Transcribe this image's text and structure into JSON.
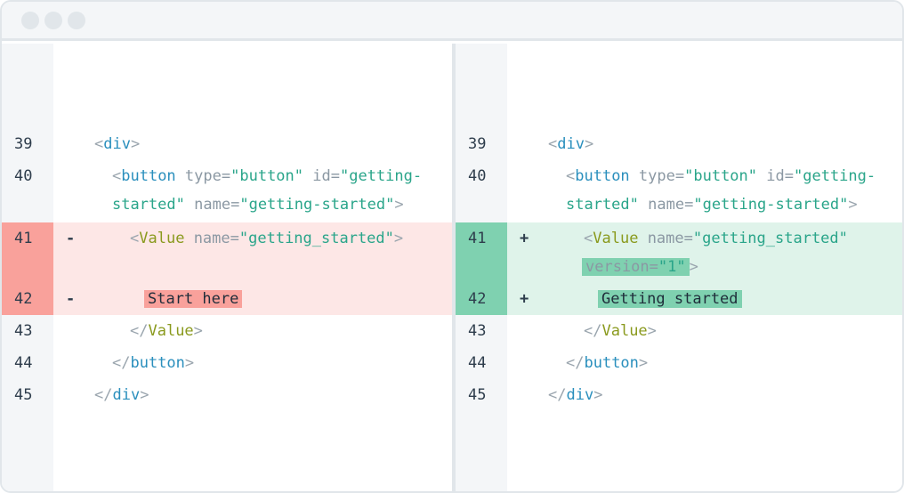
{
  "window": {
    "controls": [
      "window-dot-1",
      "window-dot-2",
      "window-dot-3"
    ]
  },
  "left": {
    "lines": [
      {
        "num": "39",
        "open": "<",
        "tag": "div",
        "close": ">"
      },
      {
        "num": "40",
        "open": "<",
        "tag": "button",
        "attr1": "type",
        "eq": "=",
        "val1": "\"button\"",
        "attr2": "id",
        "val2a": "\"getting-",
        "val2b": "started\"",
        "attr3": "name",
        "val3": "\"getting-started\"",
        "close": ">"
      },
      {
        "num": "41",
        "sign": "-",
        "open": "<",
        "tag": "Value",
        "attr1": "name",
        "eq": "=",
        "val1": "\"getting_started\"",
        "close": ">"
      },
      {
        "num": "42",
        "sign": "-",
        "text": "Start here"
      },
      {
        "num": "43",
        "open": "</",
        "tag": "Value",
        "close": ">"
      },
      {
        "num": "44",
        "open": "</",
        "tag": "button",
        "close": ">"
      },
      {
        "num": "45",
        "open": "</",
        "tag": "div",
        "close": ">"
      }
    ]
  },
  "right": {
    "lines": [
      {
        "num": "39",
        "open": "<",
        "tag": "div",
        "close": ">"
      },
      {
        "num": "40",
        "open": "<",
        "tag": "button",
        "attr1": "type",
        "eq": "=",
        "val1": "\"button\"",
        "attr2": "id",
        "val2a": "\"getting-",
        "val2b": "started\"",
        "attr3": "name",
        "val3": "\"getting-started\"",
        "close": ">"
      },
      {
        "num": "41",
        "sign": "+",
        "open": "<",
        "tag": "Value",
        "attr1": "name",
        "eq": "=",
        "val1": "\"getting_started\"",
        "attr2": "version",
        "val2": "\"1\"",
        "close": ">"
      },
      {
        "num": "42",
        "sign": "+",
        "text": "Getting started"
      },
      {
        "num": "43",
        "open": "</",
        "tag": "Value",
        "close": ">"
      },
      {
        "num": "44",
        "open": "</",
        "tag": "button",
        "close": ">"
      },
      {
        "num": "45",
        "open": "</",
        "tag": "div",
        "close": ">"
      }
    ]
  },
  "colors": {
    "deleted_background": "#fde7e6",
    "deleted_highlight": "#f9a19b",
    "added_background": "#dff3ea",
    "added_highlight": "#7fd1b0",
    "tag": "#2a8fbd",
    "string": "#2aa58a"
  }
}
